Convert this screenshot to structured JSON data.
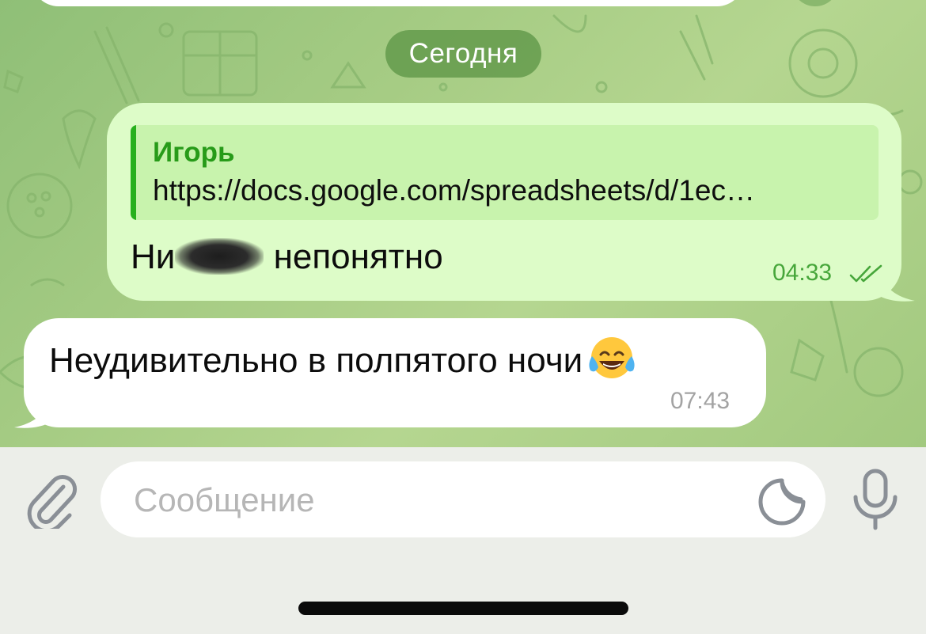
{
  "chat": {
    "date_separator": "Сегодня",
    "messages": [
      {
        "direction": "outgoing",
        "reply": {
          "author": "Игорь",
          "text": "https://docs.google.com/spreadsheets/d/1ec…"
        },
        "text_start": "Ни",
        "text_end": " непонятно",
        "time": "04:33",
        "status": "read"
      },
      {
        "direction": "incoming",
        "text": "Неудивительно в полпятого ночи",
        "emoji": "face-with-tears-of-joy",
        "time": "07:43"
      }
    ]
  },
  "composer": {
    "placeholder": "Сообщение",
    "value": ""
  },
  "icons": {
    "attach": "paperclip-icon",
    "sticker": "sticker-icon",
    "mic": "microphone-icon",
    "read_status": "double-check-icon"
  },
  "colors": {
    "outgoing_bubble": "#ddfcc8",
    "accent_green": "#279b19",
    "time_outgoing": "#46a63a",
    "time_incoming": "#a3a3a3",
    "date_chip": "#5e9646"
  }
}
